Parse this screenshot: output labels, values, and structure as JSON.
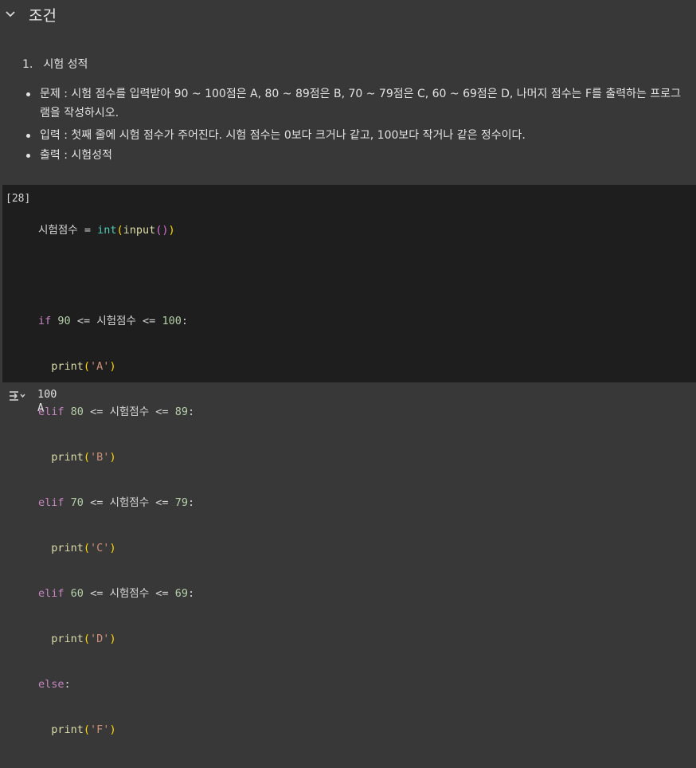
{
  "section": {
    "title": "조건"
  },
  "text_cell": {
    "ordered_item": {
      "number": "1.",
      "label": "시험 성적"
    },
    "bullets": [
      "문제 : 시험 점수를 입력받아 90 ~ 100점은 A, 80 ~ 89점은 B, 70 ~ 79점은 C, 60 ~ 69점은 D, 나머지 점수는 F를 출력하는 프로그",
      "램을 작성하시오.",
      "입력 : 첫째 줄에 시험 점수가 주어진다. 시험 점수는 0보다 크거나 같고, 100보다 작거나 같은 정수이다.",
      "출력 : 시험성적"
    ]
  },
  "code_cell": {
    "execution_count": "[28]",
    "lines": [
      "시험점수 = int(input())",
      "",
      "if 90 <= 시험점수 <= 100:",
      "  print('A')",
      "elif 80 <= 시험점수 <= 89:",
      "  print('B')",
      "elif 70 <= 시험점수 <= 79:",
      "  print('C')",
      "elif 60 <= 시험점수 <= 69:",
      "  print('D')",
      "else:",
      "  print('F')"
    ],
    "tokens": {
      "var": "시험점수",
      "eq": "=",
      "int": "int",
      "input": "input",
      "if": "if",
      "elif": "elif",
      "else": "else",
      "print": "print",
      "le": "<=",
      "n90": "90",
      "n100": "100",
      "n80": "80",
      "n89": "89",
      "n70": "70",
      "n79": "79",
      "n60": "60",
      "n69": "69",
      "sA": "'A'",
      "sB": "'B'",
      "sC": "'C'",
      "sD": "'D'",
      "sF": "'F'"
    }
  },
  "output": {
    "lines": [
      "100",
      "A"
    ]
  },
  "icons": {
    "collapse": "chevron-down-icon",
    "output_toggle": "output-toggle-icon"
  },
  "colors": {
    "background": "#383838",
    "code_background": "#1e1e1e",
    "keyword": "#c586c0",
    "function": "#dcdcaa",
    "builtin": "#4ec9b0",
    "number": "#b5cea8",
    "string": "#ce9178",
    "paren": "#ffd700"
  }
}
